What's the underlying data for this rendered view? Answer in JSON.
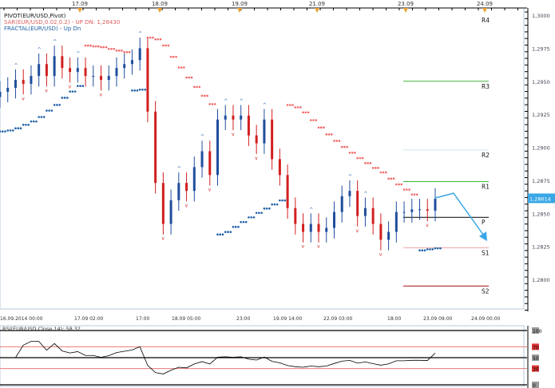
{
  "legend": {
    "pivot": "PIVOT(EUR/USD,Pivot)",
    "sar": "SAR(EUR/USD,0.02,0.2) -  UP  DN: 1,28430",
    "fractal": "FRACTAL(EUR/USD) -  Up  Dn",
    "rsi": "RSI(EUR/USD,Close,14): 58,32"
  },
  "colors": {
    "bull": "#1f4e9c",
    "bear": "#d11f1f",
    "sar_down": "#f06a6a",
    "sar_up": "#1f5fa8",
    "accent": "#39a7e6",
    "r_line": "#3cb93c",
    "s1_line": "#f0a0a0",
    "s2_line": "#a01010",
    "rsi_band": "#e57a7a"
  },
  "chart_data": {
    "type": "candlestick",
    "symbol": "EUR/USD",
    "ylim": [
      1.2775,
      1.3005
    ],
    "yticks": [
      "1,3000",
      "1,2975",
      "1,2950",
      "1,2925",
      "1,2900",
      "1,2875",
      "1,2850",
      "1,2825",
      "1,2800"
    ],
    "current_price": "1,28614",
    "date_markers": [
      "17.09",
      "18.09",
      "19.09",
      "21.09",
      "23.09",
      "24.09"
    ],
    "time_labels": [
      "16.09.2014 00:00",
      "17.09 02:00",
      "17:00",
      "18.09 05:00",
      "23:00",
      "19.09 14:00",
      "22.09 03:00",
      "18:00",
      "23.09 09:00",
      "24.09 00:00"
    ],
    "closes": [
      1.2942,
      1.2945,
      1.2951,
      1.2948,
      1.2954,
      1.2963,
      1.2954,
      1.2969,
      1.296,
      1.2957,
      1.296,
      1.2954,
      1.2954,
      1.2951,
      1.2954,
      1.296,
      1.2963,
      1.2966,
      1.2975,
      1.2927,
      1.2873,
      1.2842,
      1.286,
      1.2873,
      1.2867,
      1.2885,
      1.2897,
      1.2879,
      1.2921,
      1.2924,
      1.2921,
      1.2924,
      1.2909,
      1.2903,
      1.2921,
      1.2891,
      1.2879,
      1.2854,
      1.2842,
      1.2836,
      1.2842,
      1.2836,
      1.2839,
      1.2851,
      1.2863,
      1.2867,
      1.2848,
      1.2854,
      1.2842,
      1.283,
      1.2836,
      1.2851,
      1.2851,
      1.2853,
      1.2853,
      1.2852,
      1.2861
    ],
    "pivots": [
      {
        "label": "R4",
        "value": 1.3
      },
      {
        "label": "R3",
        "value": 1.295
      },
      {
        "label": "R2",
        "value": 1.2898
      },
      {
        "label": "R1",
        "value": 1.2874
      },
      {
        "label": "P",
        "value": 1.2847
      },
      {
        "label": "S1",
        "value": 1.2824
      },
      {
        "label": "S2",
        "value": 1.2795
      }
    ],
    "rsi": {
      "levels": [
        "100",
        "70",
        "50",
        "30",
        "0"
      ],
      "last": 58.32
    }
  }
}
